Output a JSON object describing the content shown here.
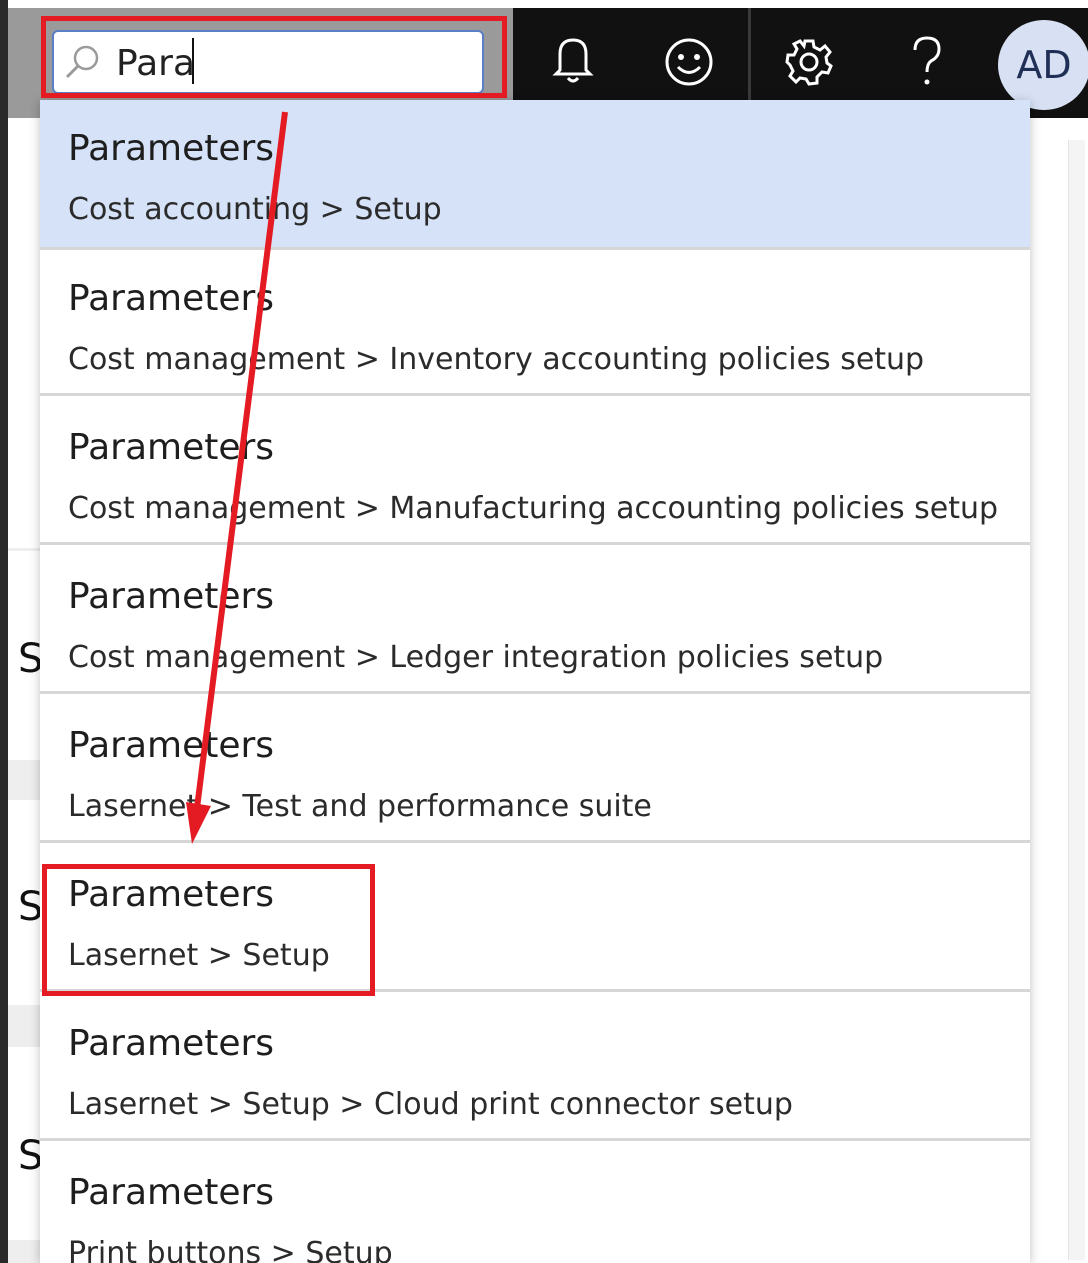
{
  "search": {
    "value": "Para",
    "icon": "search-icon"
  },
  "toolbar": {
    "icons": [
      "bell-icon",
      "smiley-icon",
      "gear-icon",
      "question-icon"
    ],
    "avatar_initials": "AD"
  },
  "background": {
    "letters": [
      "S",
      "S",
      "S"
    ]
  },
  "dropdown": {
    "items": [
      {
        "title": "Parameters",
        "path": "Cost accounting > Setup"
      },
      {
        "title": "Parameters",
        "path": "Cost management > Inventory accounting policies setup"
      },
      {
        "title": "Parameters",
        "path": "Cost management > Manufacturing accounting policies setup"
      },
      {
        "title": "Parameters",
        "path": "Cost management > Ledger integration policies setup"
      },
      {
        "title": "Parameters",
        "path": "Lasernet > Test and performance suite"
      },
      {
        "title": "Parameters",
        "path": "Lasernet > Setup"
      },
      {
        "title": "Parameters",
        "path": "Lasernet > Setup > Cloud print connector setup"
      },
      {
        "title": "Parameters",
        "path": "Print buttons > Setup"
      }
    ]
  },
  "colors": {
    "annotation": "#e41b23",
    "selected_row": "#d5e2f7",
    "topbar": "#111111"
  }
}
